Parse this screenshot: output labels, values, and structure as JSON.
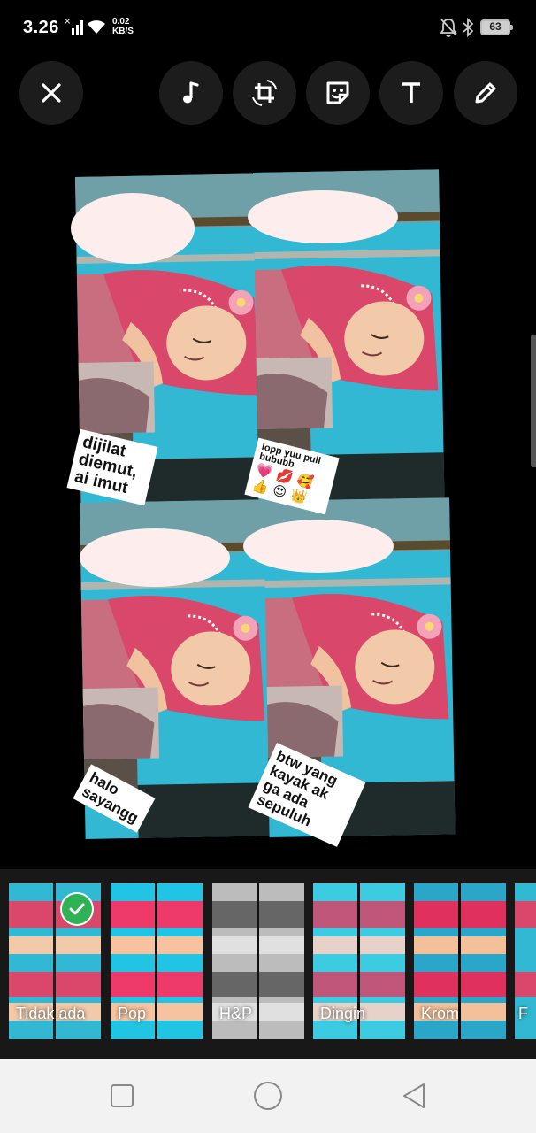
{
  "status_bar": {
    "time": "3.26",
    "net_speed_value": "0.02",
    "net_speed_unit": "KB/S",
    "battery_level": "63"
  },
  "toolbar": {
    "icons": [
      "close-icon",
      "music-note-icon",
      "crop-rotate-icon",
      "sticker-icon",
      "text-icon",
      "pencil-icon"
    ]
  },
  "stickers": [
    {
      "lines": [
        "dijilat",
        "diemut,",
        "ai imut"
      ]
    },
    {
      "line1": "lopp yuu pull",
      "line2": "bububb",
      "emoji": "💗 💋 🥰 👍 😍 👑"
    },
    {
      "lines": [
        "halo",
        "sayangg"
      ]
    },
    {
      "lines": [
        "btw  yang",
        "kayak  ak",
        "ga    ada",
        "sepuluh"
      ]
    }
  ],
  "filters": [
    {
      "label": "Tidak ada",
      "selected": true,
      "tone": "normal"
    },
    {
      "label": "Pop",
      "selected": false,
      "tone": "pop"
    },
    {
      "label": "H&P",
      "selected": false,
      "tone": "bw"
    },
    {
      "label": "Dingin",
      "selected": false,
      "tone": "cool"
    },
    {
      "label": "Krom",
      "selected": false,
      "tone": "chrome"
    },
    {
      "label": "F",
      "selected": false,
      "tone": "normal"
    }
  ],
  "colors": {
    "background": "#000000",
    "button_bg": "#1c1c1c",
    "filter_bar_bg": "#181818",
    "check_green": "#2fb155",
    "photo_cyan": "#33b8d4",
    "hijab_pink": "#d9486a",
    "navbar_bg": "#f2f2f2"
  },
  "nav_icons": [
    "recents-square-icon",
    "home-circle-icon",
    "back-triangle-icon"
  ]
}
